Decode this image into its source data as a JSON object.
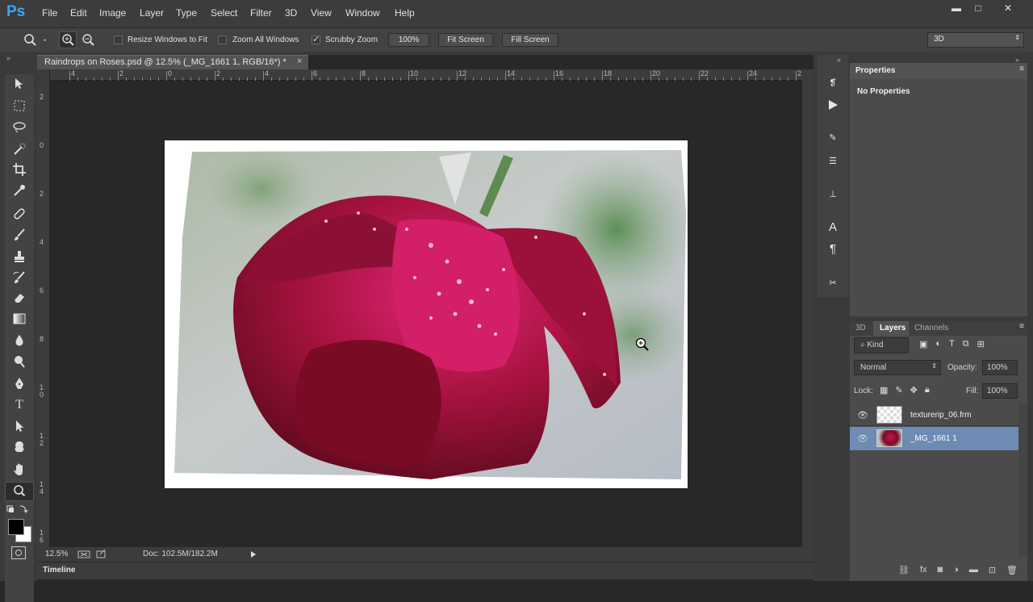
{
  "app": {
    "logo": "Ps"
  },
  "menu": [
    "File",
    "Edit",
    "Image",
    "Layer",
    "Type",
    "Select",
    "Filter",
    "3D",
    "View",
    "Window",
    "Help"
  ],
  "window_controls": {
    "minimize": "▬",
    "maximize": "□",
    "close": "✕"
  },
  "options": {
    "resize_windows": "Resize Windows to Fit",
    "zoom_all": "Zoom All Windows",
    "scrubby_zoom": "Scrubby Zoom",
    "zoom_value": "100%",
    "fit_screen": "Fit Screen",
    "fill_screen": "Fill Screen",
    "workspace": "3D"
  },
  "document": {
    "tab_title": "Raindrops on Roses.psd @ 12.5% (_MG_1661 1, RGB/16*) *",
    "close": "×"
  },
  "ruler_top": [
    "4",
    "2",
    "0",
    "2",
    "4",
    "6",
    "8",
    "10",
    "12",
    "14",
    "16",
    "18",
    "20",
    "22",
    "24",
    "2"
  ],
  "ruler_left": [
    "2",
    "0",
    "2",
    "4",
    "6",
    "8",
    "1 0",
    "1 2",
    "1 4",
    "1 6"
  ],
  "status": {
    "zoom": "12.5%",
    "doc": "Doc: 102.5M/182.2M"
  },
  "timeline": "Timeline",
  "properties": {
    "title": "Properties",
    "content": "No Properties"
  },
  "layers_panel": {
    "tabs": [
      "3D",
      "Layers",
      "Channels"
    ],
    "filter_kind": "Kind",
    "blend_mode": "Normal",
    "opacity_label": "Opacity:",
    "opacity_value": "100%",
    "lock_label": "Lock:",
    "fill_label": "Fill:",
    "fill_value": "100%",
    "layers": [
      {
        "name": "texturerip_06.frm",
        "selected": false
      },
      {
        "name": "_MG_1661 1",
        "selected": true
      }
    ]
  },
  "icons": {
    "tools": [
      "move-icon",
      "marquee-icon",
      "lasso-icon",
      "quick-select-icon",
      "crop-icon",
      "eyedropper-icon",
      "healing-brush-icon",
      "brush-icon",
      "clone-stamp-icon",
      "history-brush-icon",
      "eraser-icon",
      "gradient-icon",
      "blur-icon",
      "dodge-icon",
      "pen-icon",
      "type-icon",
      "path-select-icon",
      "shape-icon",
      "hand-icon",
      "zoom-icon"
    ],
    "accent": "#31a8ff",
    "selected_layer": "#6d8bb3"
  }
}
